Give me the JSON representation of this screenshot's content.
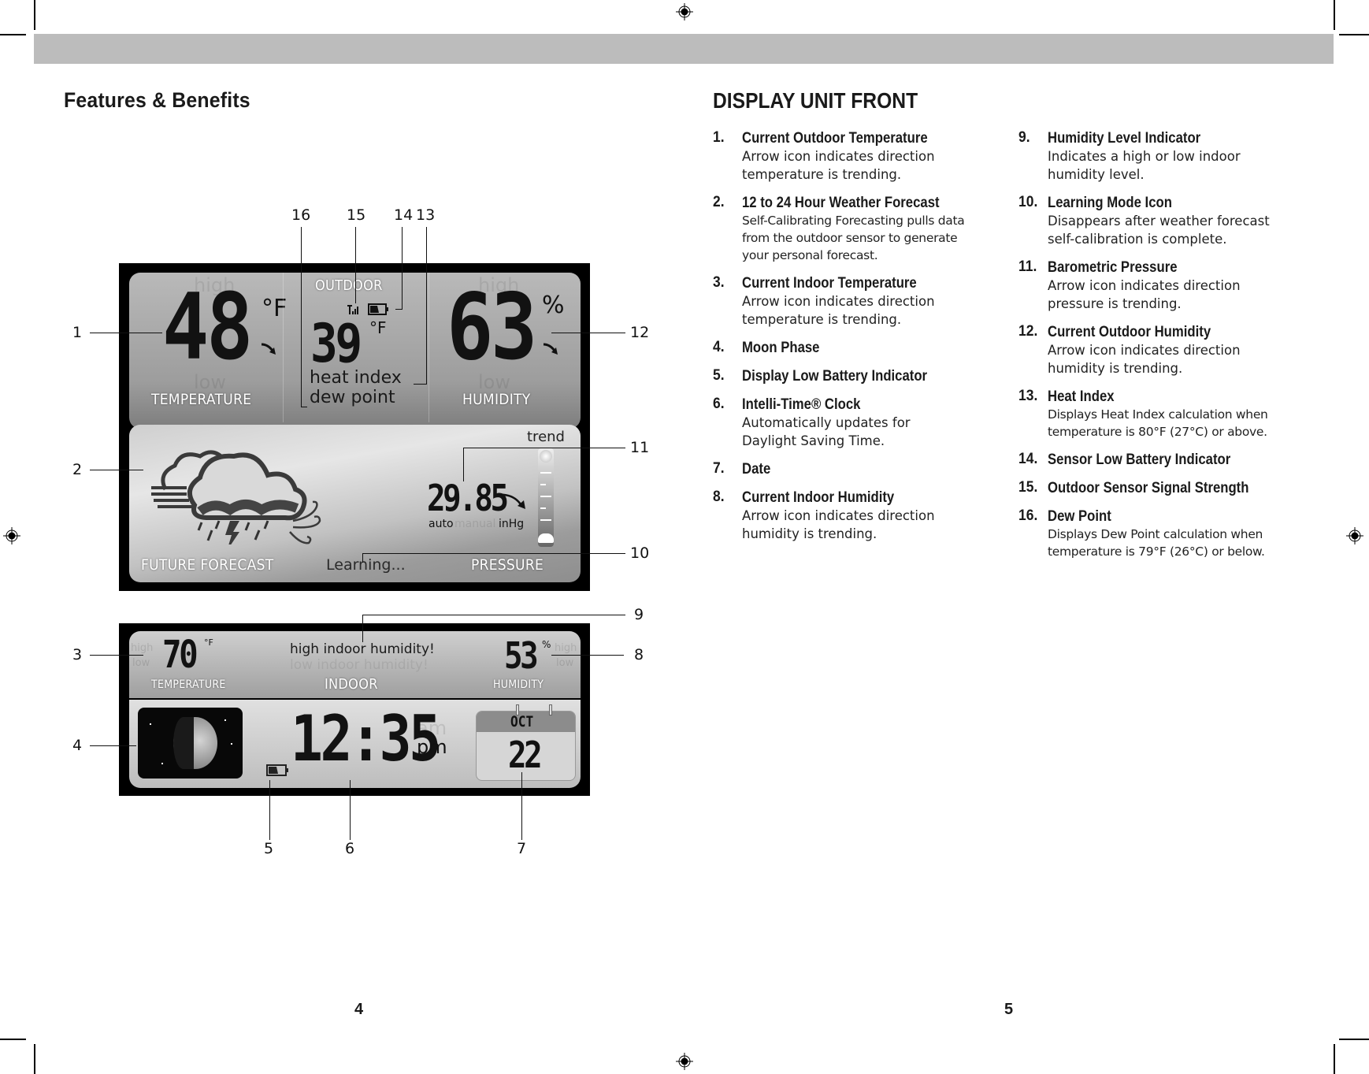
{
  "left_page": {
    "heading": "Features & Benefits",
    "page_number": "4"
  },
  "right_page": {
    "heading": "DISPLAY UNIT FRONT",
    "page_number": "5",
    "items": [
      {
        "num": "1.",
        "title": "Current Outdoor Temperature",
        "desc": "Arrow icon indicates direction\ntemperature is trending."
      },
      {
        "num": "2.",
        "title": "12 to 24 Hour Weather Forecast",
        "desc": "Self-Calibrating Forecasting pulls data\nfrom the outdoor sensor to generate\nyour personal forecast."
      },
      {
        "num": "3.",
        "title": "Current Indoor Temperature",
        "desc": "Arrow icon indicates direction\ntemperature is trending."
      },
      {
        "num": "4.",
        "title": "Moon Phase",
        "desc": ""
      },
      {
        "num": "5.",
        "title": "Display Low Battery Indicator",
        "desc": ""
      },
      {
        "num": "6.",
        "title": "Intelli-Time® Clock",
        "desc": "Automatically updates for\nDaylight Saving Time."
      },
      {
        "num": "7.",
        "title": "Date",
        "desc": ""
      },
      {
        "num": "8.",
        "title": "Current Indoor Humidity",
        "desc": "Arrow icon indicates direction\nhumidity is trending."
      },
      {
        "num": "9.",
        "title": "Humidity Level Indicator",
        "desc": "Indicates a high or low indoor\nhumidity level."
      },
      {
        "num": "10.",
        "title": "Learning Mode Icon",
        "desc": "Disappears after weather forecast\nself-calibration is complete."
      },
      {
        "num": "11.",
        "title": "Barometric Pressure",
        "desc": "Arrow icon indicates direction\npressure is trending."
      },
      {
        "num": "12.",
        "title": "Current Outdoor Humidity",
        "desc": "Arrow icon indicates direction\nhumidity is trending."
      },
      {
        "num": "13.",
        "title": "Heat Index",
        "desc": "Displays Heat Index calculation when\ntemperature is 80°F (27°C) or above."
      },
      {
        "num": "14.",
        "title": "Sensor Low Battery Indicator",
        "desc": ""
      },
      {
        "num": "15.",
        "title": "Outdoor Sensor Signal Strength",
        "desc": ""
      },
      {
        "num": "16.",
        "title": "Dew Point",
        "desc": "Displays Dew Point calculation when\ntemperature is 79°F (26°C) or below."
      }
    ]
  },
  "outdoor_display": {
    "section_label": "OUTDOOR",
    "temperature": {
      "value": "48",
      "unit": "°F",
      "label": "TEMPERATURE",
      "ghost_high": "high",
      "ghost_low": "low",
      "trend": "falling"
    },
    "heat_dew": {
      "value": "39",
      "unit": "°F",
      "heat_index_label": "heat index",
      "dew_point_label": "dew point"
    },
    "humidity": {
      "value": "63",
      "unit": "%",
      "label": "HUMIDITY",
      "ghost_high": "high",
      "ghost_low": "low",
      "trend": "falling"
    },
    "signal_icon": "signal-strength-icon",
    "battery_icon": "low-battery-icon",
    "forecast": {
      "label": "FUTURE FORECAST",
      "icon": "thunderstorm-wind-cloud-icon"
    },
    "learning_text": "Learning...",
    "pressure": {
      "label": "PRESSURE",
      "trend_label": "trend",
      "value": "29.85",
      "mode": "auto",
      "ghost_mode": "manual",
      "unit": "inHg",
      "trend": "falling"
    }
  },
  "indoor_display": {
    "section_label": "INDOOR",
    "temperature": {
      "value": "70",
      "unit": "°F",
      "label": "TEMPERATURE",
      "ghost_high": "high",
      "ghost_low": "low"
    },
    "humidity_alert": "high indoor humidity!",
    "humidity_alert_ghost": "low indoor humidity!",
    "humidity": {
      "value": "53",
      "unit": "%",
      "label": "HUMIDITY",
      "ghost_high": "high",
      "ghost_low": "low"
    },
    "clock": {
      "time": "12:35",
      "meridiem": "pm",
      "ghost_meridiem": "am"
    },
    "date": {
      "month": "OCT",
      "day": "22"
    },
    "moon_icon": "moon-phase-icon",
    "battery_icon": "display-low-battery-icon"
  },
  "callouts": [
    "1",
    "2",
    "3",
    "4",
    "5",
    "6",
    "7",
    "8",
    "9",
    "10",
    "11",
    "12",
    "13",
    "14",
    "15",
    "16"
  ]
}
